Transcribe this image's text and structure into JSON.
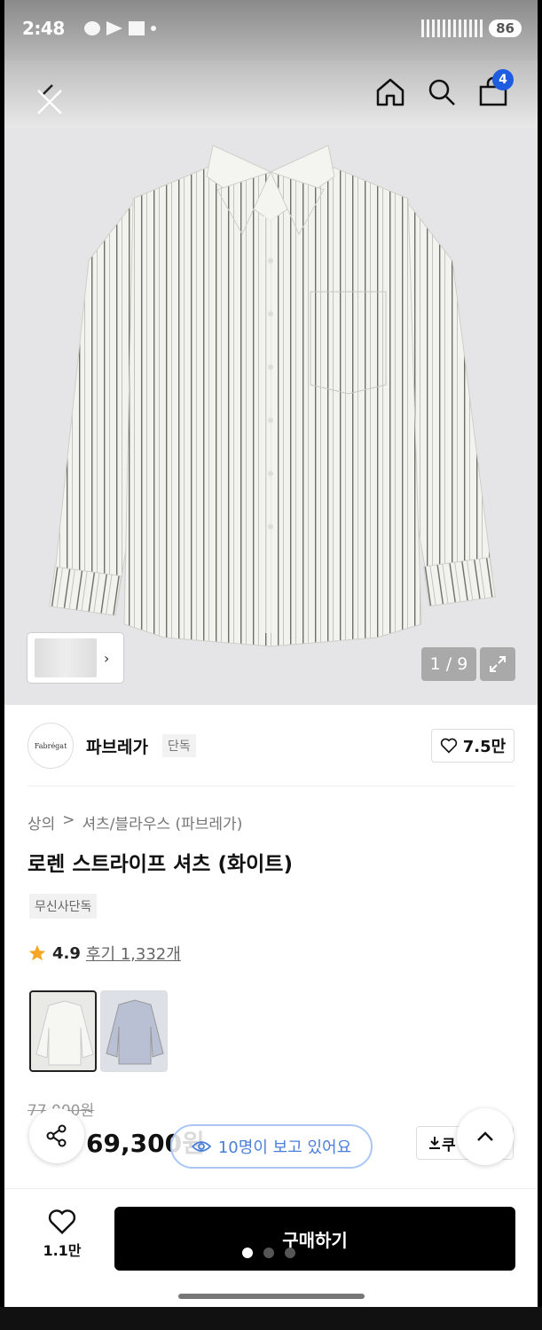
{
  "status_bar": {
    "time": "2:48",
    "battery": "86"
  },
  "header": {
    "cart_count": "4"
  },
  "gallery": {
    "counter": "1 / 9"
  },
  "brand": {
    "logo_text": "Fabrégat",
    "name": "파브레가",
    "tag": "단독",
    "likes": "7.5만"
  },
  "breadcrumb": {
    "category": "상의",
    "separator": ">",
    "subcategory": "셔츠/블라우스 (파브레가)"
  },
  "product": {
    "title": "로렌 스트라이프 셔츠 (화이트)",
    "exclusive_tag": "무신사단독",
    "rating": "4.9",
    "reviews": "후기 1,332개",
    "original_price": "77,000원",
    "price": "69,300원",
    "viewers": "10명이 보고 있어요",
    "coupon": "쿠"
  },
  "bottom_bar": {
    "wish_count": "1.1만",
    "buy_label": "구매하기"
  },
  "colors": {
    "accent": "#1e5de0",
    "viewers": "#4a7fd9",
    "star": "#f5a623",
    "buy": "#000000"
  }
}
